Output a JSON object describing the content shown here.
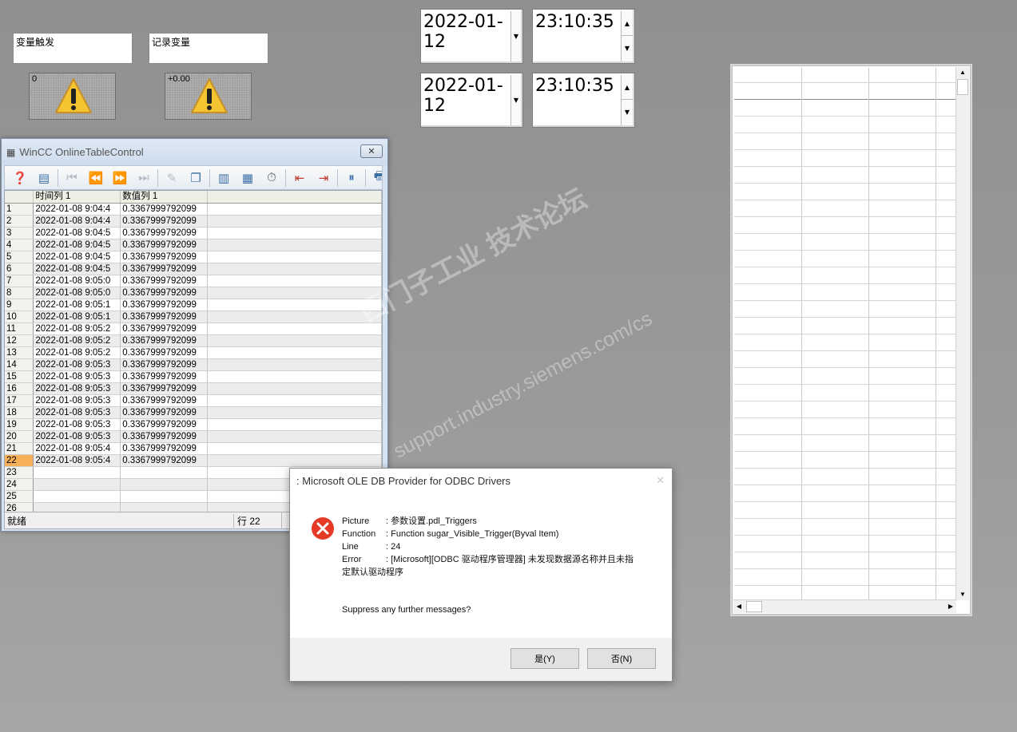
{
  "top_labels": {
    "var_trigger": "变量触发",
    "record_var": "记录变量"
  },
  "indicators": [
    {
      "value": "0",
      "icon": "warning-icon"
    },
    {
      "value": "+0.00",
      "icon": "warning-icon"
    }
  ],
  "datetime": {
    "start_date": "2022-01-12",
    "start_time": "23:10:35",
    "end_date": "2022-01-12",
    "end_time": "23:10:35"
  },
  "table_window": {
    "title": "WinCC OnlineTableControl",
    "columns": [
      "时间列 1",
      "数值列 1"
    ],
    "rows": [
      [
        "1",
        "2022-01-08 9:04:4",
        "0.3367999792099"
      ],
      [
        "2",
        "2022-01-08 9:04:4",
        "0.3367999792099"
      ],
      [
        "3",
        "2022-01-08 9:04:5",
        "0.3367999792099"
      ],
      [
        "4",
        "2022-01-08 9:04:5",
        "0.3367999792099"
      ],
      [
        "5",
        "2022-01-08 9:04:5",
        "0.3367999792099"
      ],
      [
        "6",
        "2022-01-08 9:04:5",
        "0.3367999792099"
      ],
      [
        "7",
        "2022-01-08 9:05:0",
        "0.3367999792099"
      ],
      [
        "8",
        "2022-01-08 9:05:0",
        "0.3367999792099"
      ],
      [
        "9",
        "2022-01-08 9:05:1",
        "0.3367999792099"
      ],
      [
        "10",
        "2022-01-08 9:05:1",
        "0.3367999792099"
      ],
      [
        "11",
        "2022-01-08 9:05:2",
        "0.3367999792099"
      ],
      [
        "12",
        "2022-01-08 9:05:2",
        "0.3367999792099"
      ],
      [
        "13",
        "2022-01-08 9:05:2",
        "0.3367999792099"
      ],
      [
        "14",
        "2022-01-08 9:05:3",
        "0.3367999792099"
      ],
      [
        "15",
        "2022-01-08 9:05:3",
        "0.3367999792099"
      ],
      [
        "16",
        "2022-01-08 9:05:3",
        "0.3367999792099"
      ],
      [
        "17",
        "2022-01-08 9:05:3",
        "0.3367999792099"
      ],
      [
        "18",
        "2022-01-08 9:05:3",
        "0.3367999792099"
      ],
      [
        "19",
        "2022-01-08 9:05:3",
        "0.3367999792099"
      ],
      [
        "20",
        "2022-01-08 9:05:3",
        "0.3367999792099"
      ],
      [
        "21",
        "2022-01-08 9:05:4",
        "0.3367999792099"
      ],
      [
        "22",
        "2022-01-08 9:05:4",
        "0.3367999792099"
      ],
      [
        "23",
        "",
        ""
      ],
      [
        "24",
        "",
        ""
      ],
      [
        "25",
        "",
        ""
      ],
      [
        "26",
        "",
        ""
      ]
    ],
    "status_ready": "就绪",
    "status_row": "行 22",
    "toolbar_icons": [
      "help-icon",
      "config-icon",
      "first-icon",
      "prev-page-icon",
      "next-page-icon",
      "last-icon",
      "edit-icon",
      "copy-icon",
      "column-select-icon",
      "column-props-icon",
      "time-select-icon",
      "move-left-icon",
      "move-right-icon",
      "pause-icon",
      "print-icon"
    ]
  },
  "dialog": {
    "title": ": Microsoft OLE DB Provider for ODBC Drivers",
    "picture_label": "Picture",
    "picture_value": ": 参数设置.pdl_Triggers",
    "function_label": "Function",
    "function_value": ": Function sugar_Visible_Trigger(Byval Item)",
    "line_label": "Line",
    "line_value": ": 24",
    "error_label": "Error",
    "error_value": ": [Microsoft][ODBC 驱动程序管理器] 未发现数据源名称并且未指",
    "error_value2": "定默认驱动程序",
    "question": "Suppress any further messages?",
    "yes": "是(Y)",
    "no": "否(N)",
    "close": "✕"
  },
  "watermark": {
    "line1": "西门子工业 技术论坛",
    "line2": "support.industry.siemens.com/cs"
  }
}
